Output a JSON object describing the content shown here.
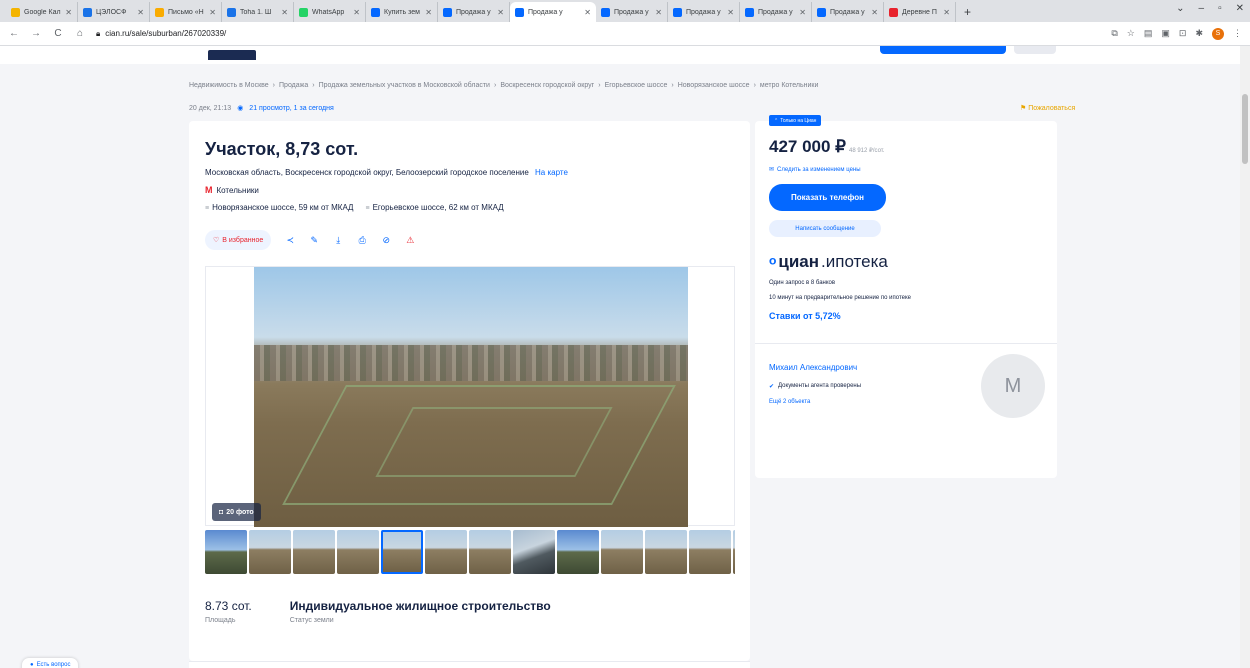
{
  "browser": {
    "tabs": [
      {
        "title": "Google Кал",
        "color": "#f4b400"
      },
      {
        "title": "ЦЭЛОСФ",
        "color": "#1a73e8"
      },
      {
        "title": "Письмо «Н",
        "color": "#f9ab00"
      },
      {
        "title": "Toha 1. Ш",
        "color": "#1a73e8"
      },
      {
        "title": "WhatsApp",
        "color": "#25d366"
      },
      {
        "title": "Купить зем",
        "color": "#0468ff"
      },
      {
        "title": "Продажа у",
        "color": "#0468ff"
      },
      {
        "title": "Продажа у",
        "color": "#0468ff",
        "active": true
      },
      {
        "title": "Продажа у",
        "color": "#0468ff"
      },
      {
        "title": "Продажа у",
        "color": "#0468ff"
      },
      {
        "title": "Продажа у",
        "color": "#0468ff"
      },
      {
        "title": "Продажа у",
        "color": "#0468ff"
      },
      {
        "title": "Деревне П",
        "color": "#e8232d"
      }
    ],
    "new_tab": "+",
    "window_controls": [
      "⌄",
      "–",
      "▫",
      "✕"
    ],
    "nav": {
      "back": "←",
      "forward": "→",
      "reload": "C",
      "home": "⌂"
    },
    "url": "cian.ru/sale/suburban/267020339/",
    "profile_initial": "S"
  },
  "breadcrumbs": [
    "Недвижимость в Москве",
    "Продажа",
    "Продажа земельных участков в Московской области",
    "Воскресенск городской округ",
    "Егорьевское шоссе",
    "Новорязанское шоссе",
    "метро Котельники"
  ],
  "meta": {
    "date": "20 дек, 21:13",
    "views": "21 просмотр, 1 за сегодня",
    "complain": "Пожаловаться"
  },
  "listing": {
    "title": "Участок, 8,73 сот.",
    "address": "Московская область, Воскресенск городской округ, Белоозерский городское поселение",
    "map_link": "На карте",
    "metro": "Котельники",
    "highways": [
      "Новорязанское шоссе, 59 км от МКАД",
      "Егорьевское шоссе, 62 км от МКАД"
    ],
    "favorite_label": "В избранное",
    "photo_count": "20 фото",
    "thumbnail_count": 13,
    "selected_thumbnail": 4,
    "facts": [
      {
        "value": "8.73 сот.",
        "label": "Площадь"
      },
      {
        "value": "Индивидуальное жилищное строительство",
        "label": "Статус земли"
      }
    ]
  },
  "sidebar": {
    "badge": "Только на Циан",
    "price": "427 000 ₽",
    "price_per_unit": "48 912 ₽/сот.",
    "price_tracking": "Следить за изменением цены",
    "phone_button": "Показать телефон",
    "message_button": "Написать сообщение",
    "ipoteka": {
      "brand": "циан",
      "suffix": ".ипотека",
      "line1": "Один запрос в 8 банков",
      "line2": "10 минут на предварительное решение по ипотеке",
      "rate": "Ставки от 5,72%"
    },
    "agent": {
      "name": "Михаил Александрович",
      "verified": "Документы агента проверены",
      "more": "Ещё 2 объекта",
      "avatar_initial": "М"
    }
  },
  "help_chip": "Есть вопрос",
  "colors": {
    "accent": "#0468ff",
    "danger": "#e8232d",
    "text": "#152242"
  }
}
